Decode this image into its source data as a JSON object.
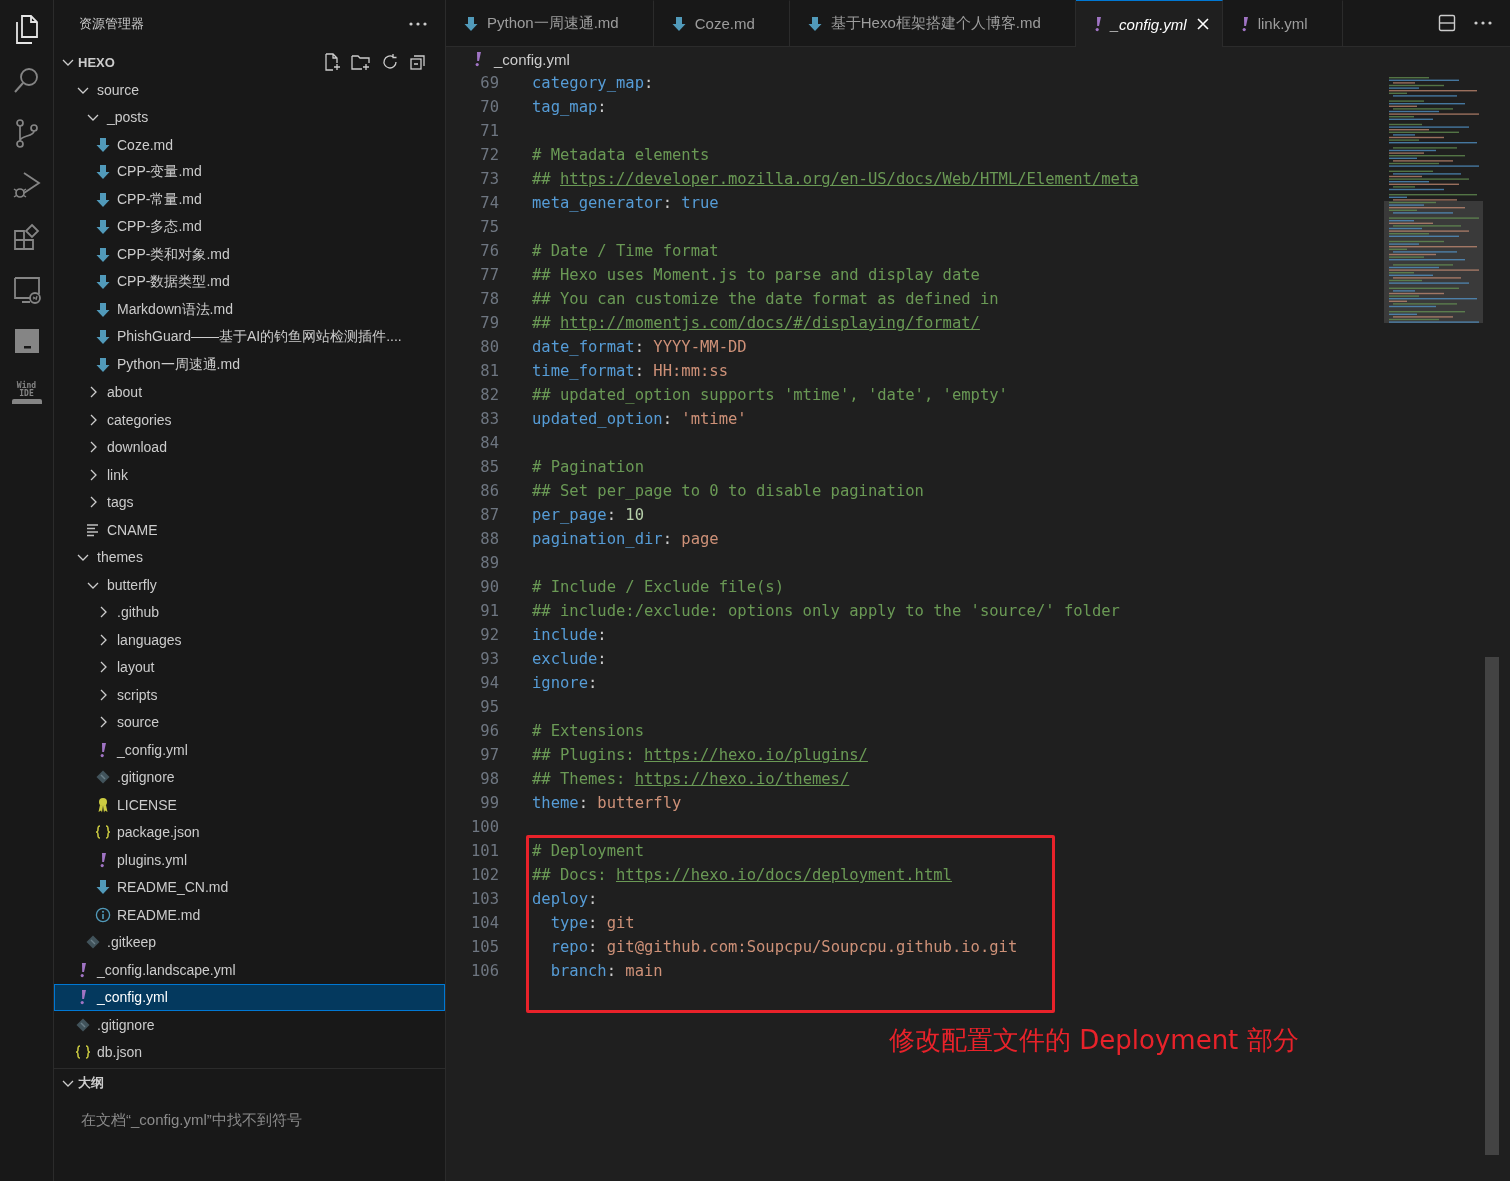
{
  "activity_bar": [
    {
      "kind": "explorer",
      "selected": true
    },
    {
      "kind": "search",
      "selected": false
    },
    {
      "kind": "source-control",
      "selected": false
    },
    {
      "kind": "run-debug",
      "selected": false
    },
    {
      "kind": "extensions",
      "selected": false
    },
    {
      "kind": "remote",
      "selected": false
    },
    {
      "kind": "panel",
      "selected": false
    },
    {
      "kind": "wind",
      "selected": false,
      "label": "Wind IDE"
    }
  ],
  "sidebar": {
    "title": "资源管理器",
    "section": {
      "label": "HEXO",
      "expanded": true
    },
    "tree": [
      {
        "label": "source",
        "kind": "folder",
        "expanded": true,
        "selected": false,
        "children": [
          {
            "label": "_posts",
            "kind": "folder",
            "expanded": true,
            "selected": false,
            "children": [
              {
                "label": "Coze.md",
                "kind": "md",
                "selected": false
              },
              {
                "label": "CPP-变量.md",
                "kind": "md",
                "selected": false
              },
              {
                "label": "CPP-常量.md",
                "kind": "md",
                "selected": false
              },
              {
                "label": "CPP-多态.md",
                "kind": "md",
                "selected": false
              },
              {
                "label": "CPP-类和对象.md",
                "kind": "md",
                "selected": false
              },
              {
                "label": "CPP-数据类型.md",
                "kind": "md",
                "selected": false
              },
              {
                "label": "Markdown语法.md",
                "kind": "md",
                "selected": false
              },
              {
                "label": "PhishGuard——基于AI的钓鱼网站检测插件....",
                "kind": "md",
                "selected": false
              },
              {
                "label": "Python一周速通.md",
                "kind": "md",
                "selected": false
              }
            ]
          },
          {
            "label": "about",
            "kind": "folder",
            "expanded": false,
            "selected": false
          },
          {
            "label": "categories",
            "kind": "folder",
            "expanded": false,
            "selected": false
          },
          {
            "label": "download",
            "kind": "folder",
            "expanded": false,
            "selected": false
          },
          {
            "label": "link",
            "kind": "folder",
            "expanded": false,
            "selected": false
          },
          {
            "label": "tags",
            "kind": "folder",
            "expanded": false,
            "selected": false
          },
          {
            "label": "CNAME",
            "kind": "text",
            "selected": false
          }
        ]
      },
      {
        "label": "themes",
        "kind": "folder",
        "expanded": true,
        "selected": false,
        "children": [
          {
            "label": "butterfly",
            "kind": "folder",
            "expanded": true,
            "selected": false,
            "children": [
              {
                "label": ".github",
                "kind": "folder",
                "expanded": false,
                "selected": false
              },
              {
                "label": "languages",
                "kind": "folder",
                "expanded": false,
                "selected": false
              },
              {
                "label": "layout",
                "kind": "folder",
                "expanded": false,
                "selected": false
              },
              {
                "label": "scripts",
                "kind": "folder",
                "expanded": false,
                "selected": false
              },
              {
                "label": "source",
                "kind": "folder",
                "expanded": false,
                "selected": false
              },
              {
                "label": "_config.yml",
                "kind": "yml",
                "selected": false
              },
              {
                "label": ".gitignore",
                "kind": "git",
                "selected": false
              },
              {
                "label": "LICENSE",
                "kind": "license",
                "selected": false
              },
              {
                "label": "package.json",
                "kind": "json",
                "selected": false
              },
              {
                "label": "plugins.yml",
                "kind": "yml",
                "selected": false
              },
              {
                "label": "README_CN.md",
                "kind": "md",
                "selected": false
              },
              {
                "label": "README.md",
                "kind": "info",
                "selected": false
              }
            ]
          },
          {
            "label": ".gitkeep",
            "kind": "git",
            "selected": false
          }
        ]
      },
      {
        "label": "_config.landscape.yml",
        "kind": "yml",
        "selected": false
      },
      {
        "label": "_config.yml",
        "kind": "yml",
        "selected": true
      },
      {
        "label": ".gitignore",
        "kind": "git",
        "selected": false
      },
      {
        "label": "db.json",
        "kind": "json",
        "selected": false
      }
    ],
    "outline": {
      "label": "大纲",
      "expanded": true,
      "message": "在文档“_config.yml”中找不到符号"
    }
  },
  "tabs": [
    {
      "label": "Python一周速通.md",
      "kind": "md",
      "selected": false
    },
    {
      "label": "Coze.md",
      "kind": "md",
      "selected": false
    },
    {
      "label": "基于Hexo框架搭建个人博客.md",
      "kind": "md",
      "selected": false
    },
    {
      "label": "_config.yml",
      "kind": "yml",
      "selected": true
    },
    {
      "label": "link.yml",
      "kind": "yml",
      "selected": false
    }
  ],
  "breadcrumb": {
    "label": "_config.yml",
    "kind": "yml"
  },
  "code": [
    {
      "number": "69",
      "tokens": [
        {
          "kind": "key",
          "text": "category_map"
        },
        {
          "kind": "punct",
          "text": ":"
        }
      ]
    },
    {
      "number": "70",
      "tokens": [
        {
          "kind": "key",
          "text": "tag_map"
        },
        {
          "kind": "punct",
          "text": ":"
        }
      ]
    },
    {
      "number": "71"
    },
    {
      "number": "72",
      "tokens": [
        {
          "kind": "comment",
          "text": "# Metadata elements"
        }
      ]
    },
    {
      "number": "73",
      "tokens": [
        {
          "kind": "comment",
          "text": "## "
        },
        {
          "kind": "link",
          "text": "https://developer.mozilla.org/en-US/docs/Web/HTML/Element/meta"
        }
      ]
    },
    {
      "number": "74",
      "tokens": [
        {
          "kind": "key",
          "text": "meta_generator"
        },
        {
          "kind": "punct",
          "text": ": "
        },
        {
          "kind": "bool",
          "text": "true"
        }
      ]
    },
    {
      "number": "75"
    },
    {
      "number": "76",
      "tokens": [
        {
          "kind": "comment",
          "text": "# Date / Time format"
        }
      ]
    },
    {
      "number": "77",
      "tokens": [
        {
          "kind": "comment",
          "text": "## Hexo uses Moment.js to parse and display date"
        }
      ]
    },
    {
      "number": "78",
      "tokens": [
        {
          "kind": "comment",
          "text": "## You can customize the date format as defined in"
        }
      ]
    },
    {
      "number": "79",
      "tokens": [
        {
          "kind": "comment",
          "text": "## "
        },
        {
          "kind": "link",
          "text": "http://momentjs.com/docs/#/displaying/format/"
        }
      ]
    },
    {
      "number": "80",
      "tokens": [
        {
          "kind": "key",
          "text": "date_format"
        },
        {
          "kind": "punct",
          "text": ": "
        },
        {
          "kind": "string",
          "text": "YYYY-MM-DD"
        }
      ]
    },
    {
      "number": "81",
      "tokens": [
        {
          "kind": "key",
          "text": "time_format"
        },
        {
          "kind": "punct",
          "text": ": "
        },
        {
          "kind": "string",
          "text": "HH:mm:ss"
        }
      ]
    },
    {
      "number": "82",
      "tokens": [
        {
          "kind": "comment",
          "text": "## updated_option supports 'mtime', 'date', 'empty'"
        }
      ]
    },
    {
      "number": "83",
      "tokens": [
        {
          "kind": "key",
          "text": "updated_option"
        },
        {
          "kind": "punct",
          "text": ": "
        },
        {
          "kind": "string",
          "text": "'mtime'"
        }
      ]
    },
    {
      "number": "84"
    },
    {
      "number": "85",
      "tokens": [
        {
          "kind": "comment",
          "text": "# Pagination"
        }
      ]
    },
    {
      "number": "86",
      "tokens": [
        {
          "kind": "comment",
          "text": "## Set per_page to 0 to disable pagination"
        }
      ]
    },
    {
      "number": "87",
      "tokens": [
        {
          "kind": "key",
          "text": "per_page"
        },
        {
          "kind": "punct",
          "text": ": "
        },
        {
          "kind": "number",
          "text": "10"
        }
      ]
    },
    {
      "number": "88",
      "tokens": [
        {
          "kind": "key",
          "text": "pagination_dir"
        },
        {
          "kind": "punct",
          "text": ": "
        },
        {
          "kind": "string",
          "text": "page"
        }
      ]
    },
    {
      "number": "89"
    },
    {
      "number": "90",
      "tokens": [
        {
          "kind": "comment",
          "text": "# Include / Exclude file(s)"
        }
      ]
    },
    {
      "number": "91",
      "tokens": [
        {
          "kind": "comment",
          "text": "## include:/exclude: options only apply to the 'source/' folder"
        }
      ]
    },
    {
      "number": "92",
      "tokens": [
        {
          "kind": "key",
          "text": "include"
        },
        {
          "kind": "punct",
          "text": ":"
        }
      ]
    },
    {
      "number": "93",
      "tokens": [
        {
          "kind": "key",
          "text": "exclude"
        },
        {
          "kind": "punct",
          "text": ":"
        }
      ]
    },
    {
      "number": "94",
      "tokens": [
        {
          "kind": "key",
          "text": "ignore"
        },
        {
          "kind": "punct",
          "text": ":"
        }
      ]
    },
    {
      "number": "95"
    },
    {
      "number": "96",
      "tokens": [
        {
          "kind": "comment",
          "text": "# Extensions"
        }
      ]
    },
    {
      "number": "97",
      "tokens": [
        {
          "kind": "comment",
          "text": "## Plugins: "
        },
        {
          "kind": "link",
          "text": "https://hexo.io/plugins/"
        }
      ]
    },
    {
      "number": "98",
      "tokens": [
        {
          "kind": "comment",
          "text": "## Themes: "
        },
        {
          "kind": "link",
          "text": "https://hexo.io/themes/"
        }
      ]
    },
    {
      "number": "99",
      "tokens": [
        {
          "kind": "key",
          "text": "theme"
        },
        {
          "kind": "punct",
          "text": ": "
        },
        {
          "kind": "string",
          "text": "butterfly"
        }
      ]
    },
    {
      "number": "100"
    },
    {
      "number": "101",
      "highlighted": true,
      "tokens": [
        {
          "kind": "comment",
          "text": "# Deployment"
        }
      ]
    },
    {
      "number": "102",
      "highlighted": true,
      "tokens": [
        {
          "kind": "comment",
          "text": "## Docs: "
        },
        {
          "kind": "link",
          "text": "https://hexo.io/docs/deployment.html"
        }
      ]
    },
    {
      "number": "103",
      "highlighted": true,
      "tokens": [
        {
          "kind": "key",
          "text": "deploy"
        },
        {
          "kind": "punct",
          "text": ":"
        }
      ]
    },
    {
      "number": "104",
      "highlighted": true,
      "tokens": [
        {
          "kind": "key",
          "text": "  type"
        },
        {
          "kind": "punct",
          "text": ": "
        },
        {
          "kind": "string",
          "text": "git"
        }
      ]
    },
    {
      "number": "105",
      "highlighted": true,
      "tokens": [
        {
          "kind": "key",
          "text": "  repo"
        },
        {
          "kind": "punct",
          "text": ": "
        },
        {
          "kind": "string",
          "text": "git@github.com:Soupcpu/Soupcpu.github.io.git"
        }
      ]
    },
    {
      "number": "106",
      "highlighted": true,
      "tokens": [
        {
          "kind": "key",
          "text": "  branch"
        },
        {
          "kind": "punct",
          "text": ": "
        },
        {
          "kind": "string",
          "text": "main"
        }
      ]
    }
  ],
  "annotation": {
    "text": "修改配置文件的 Deployment 部分"
  }
}
